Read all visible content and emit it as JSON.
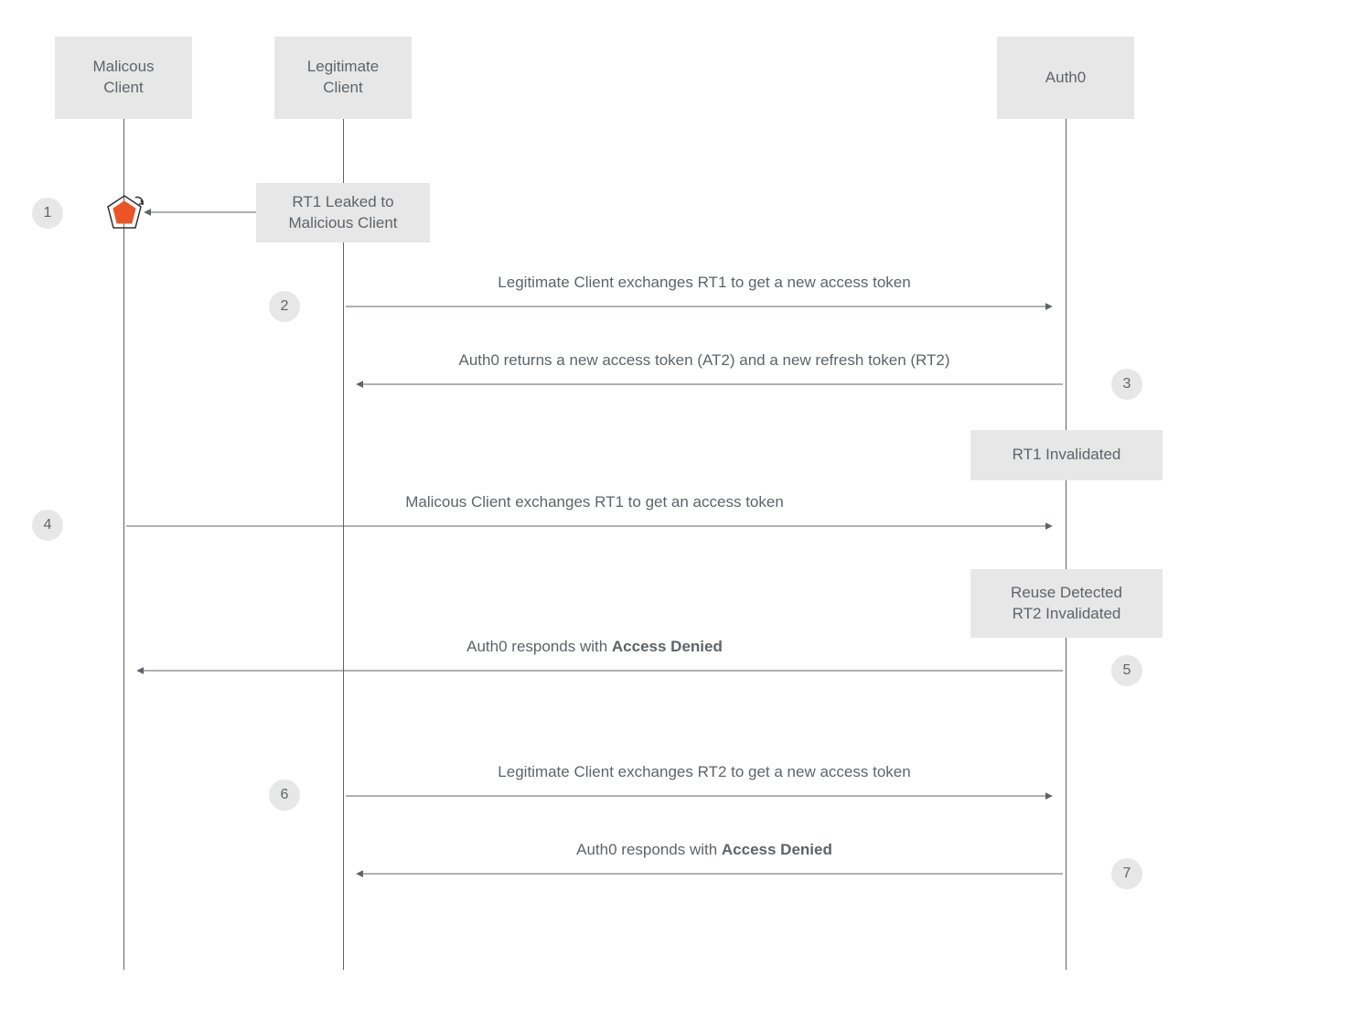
{
  "actors": {
    "malicious": "Malicous\nClient",
    "legitimate": "Legitimate\nClient",
    "auth0": "Auth0"
  },
  "notes": {
    "leak": "RT1 Leaked to\nMalicious Client",
    "rt1_invalidated": "RT1 Invalidated",
    "reuse_detected": "Reuse Detected\nRT2 Invalidated"
  },
  "messages": {
    "m2": "Legitimate Client exchanges RT1 to get a new access token",
    "m3": "Auth0 returns a new access token (AT2) and a new refresh token (RT2)",
    "m4": "Malicous Client exchanges RT1 to get an access token",
    "m5_prefix": "Auth0 responds with ",
    "m5_bold": "Access Denied",
    "m6": "Legitimate Client exchanges RT2 to get a new access token",
    "m7_prefix": "Auth0 responds with ",
    "m7_bold": "Access Denied"
  },
  "steps": {
    "s1": "1",
    "s2": "2",
    "s3": "3",
    "s4": "4",
    "s5": "5",
    "s6": "6",
    "s7": "7"
  },
  "colors": {
    "box_bg": "#e7e7e7",
    "line": "#5f6368",
    "accent_orange": "#eb5424"
  }
}
